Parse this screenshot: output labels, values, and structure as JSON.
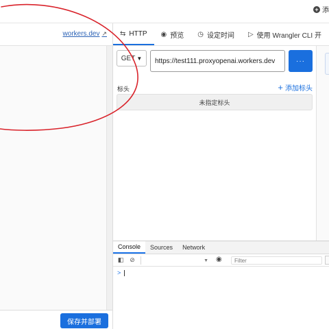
{
  "top": {
    "add_label": "添"
  },
  "left": {
    "link_text": "workers.dev",
    "deploy_label": "保存并部署"
  },
  "tabs": [
    {
      "label": "HTTP",
      "icon": "arrows-exchange-icon"
    },
    {
      "label": "预览",
      "icon": "eye-icon"
    },
    {
      "label": "设定时间",
      "icon": "clock-icon"
    },
    {
      "label": "使用 Wrangler CLI 开",
      "icon": "terminal-icon"
    }
  ],
  "request": {
    "method": "GET",
    "url": "https://test111.proxyopenai.workers.dev",
    "send_label": "···",
    "headers_label": "标头",
    "add_header_label": "添加标头",
    "no_headers_label": "未指定标头"
  },
  "devtools": {
    "tabs": [
      "Console",
      "Sources",
      "Network"
    ],
    "context_caret": "▼",
    "filter_placeholder": "Filter",
    "prompt": ">"
  },
  "colors": {
    "accent": "#1a6fde",
    "annotation": "#d9222a"
  }
}
